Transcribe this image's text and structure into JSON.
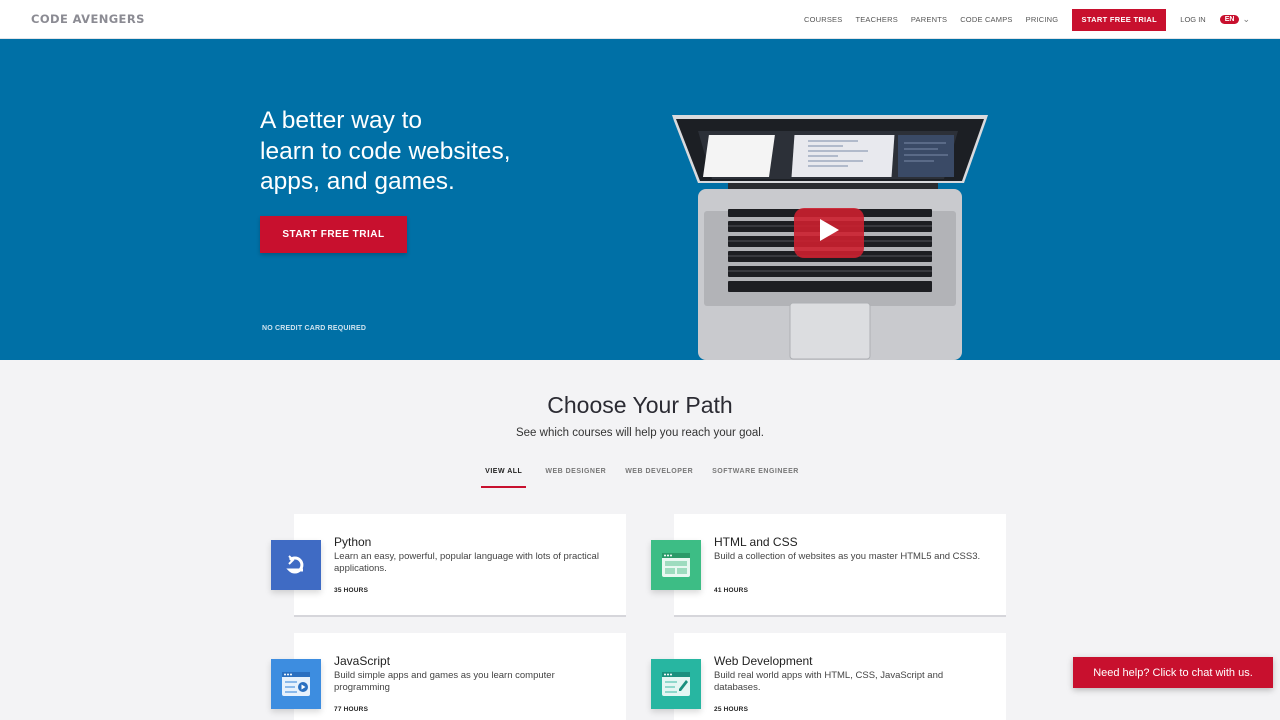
{
  "header": {
    "logo": "CODE AVENGERS",
    "nav": [
      "COURSES",
      "TEACHERS",
      "PARENTS",
      "CODE CAMPS",
      "PRICING"
    ],
    "cta": "START FREE TRIAL",
    "login": "LOG IN",
    "lang": "EN"
  },
  "hero": {
    "title_line1": "A better way to",
    "title_line2": "learn to code websites,",
    "title_line3": "apps, and games.",
    "cta": "START FREE TRIAL",
    "note": "NO CREDIT CARD REQUIRED"
  },
  "paths": {
    "title": "Choose Your Path",
    "subtitle": "See which courses will help you reach your goal.",
    "tabs": [
      "VIEW ALL",
      "WEB DESIGNER",
      "WEB DEVELOPER",
      "SOFTWARE ENGINEER"
    ],
    "active_tab": "VIEW ALL"
  },
  "courses": [
    {
      "title": "Python",
      "desc": "Learn an easy, powerful, popular language with lots of practical applications.",
      "hours": "35 HOURS",
      "icon": "python-icon",
      "color": "#3f6bc4"
    },
    {
      "title": "HTML and CSS",
      "desc": "Build a collection of websites as you master HTML5 and CSS3.",
      "hours": "41 HOURS",
      "icon": "html-css-icon",
      "color": "#3dbd85"
    },
    {
      "title": "JavaScript",
      "desc": "Build simple apps and games as you learn computer programming",
      "hours": "77 HOURS",
      "icon": "javascript-icon",
      "color": "#3d8de0"
    },
    {
      "title": "Web Development",
      "desc": "Build real world apps with HTML, CSS, JavaScript and databases.",
      "hours": "25 HOURS",
      "icon": "web-development-icon",
      "color": "#27b6a1"
    }
  ],
  "chat": {
    "label": "Need help? Click to chat with us."
  },
  "colors": {
    "brand_red": "#c8102e",
    "hero_blue": "#0070a6",
    "page_bg": "#f3f3f5"
  }
}
